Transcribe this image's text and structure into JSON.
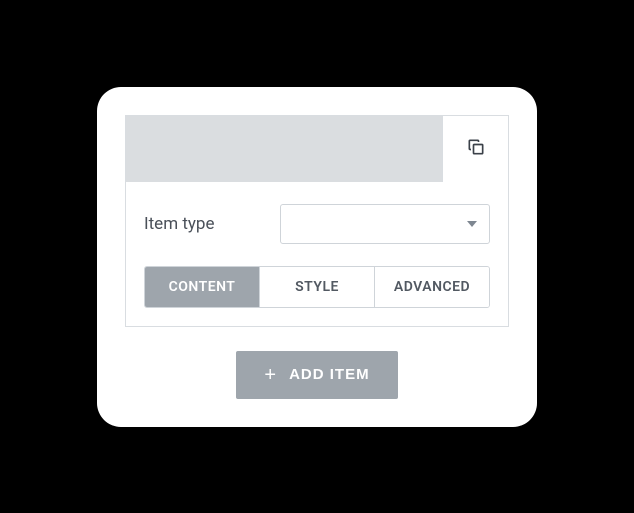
{
  "item": {
    "type_label": "Item type",
    "type_value": "",
    "tabs": {
      "content": "CONTENT",
      "style": "STYLE",
      "advanced": "ADVANCED"
    }
  },
  "actions": {
    "add_item": "ADD ITEM"
  }
}
